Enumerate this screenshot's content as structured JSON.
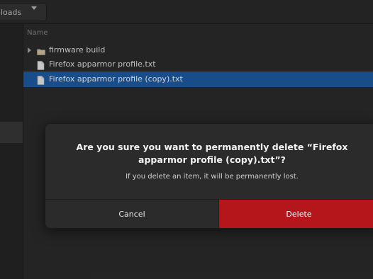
{
  "header": {
    "path_label": "loads"
  },
  "filelist": {
    "column_name": "Name",
    "rows": [
      {
        "name": "firmware build",
        "type": "folder"
      },
      {
        "name": "Firefox apparmor profile.txt",
        "type": "file"
      },
      {
        "name": "Firefox apparmor profile (copy).txt",
        "type": "file"
      }
    ]
  },
  "dialog": {
    "title_line1": "Are you sure you want to permanently delete “Firefox",
    "title_line2": "apparmor profile (copy).txt”?",
    "body": "If you delete an item, it will be permanently lost.",
    "cancel_label": "Cancel",
    "delete_label": "Delete"
  },
  "colors": {
    "selection": "#1f5fa8",
    "destructive": "#b5161c"
  },
  "icons": {
    "folder": "folder-icon",
    "file": "text-file-icon",
    "expander": "chevron-right-icon",
    "path_dropdown": "chevron-down-icon"
  }
}
